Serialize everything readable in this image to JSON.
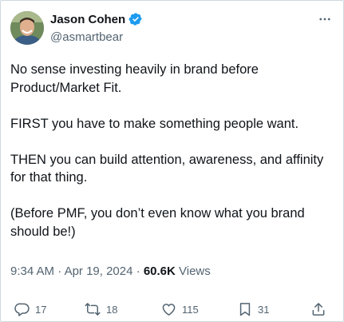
{
  "author": {
    "display_name": "Jason Cohen",
    "handle": "@asmartbear",
    "verified": true
  },
  "tweet": {
    "paragraphs": [
      "No sense investing heavily in brand before Product/Market Fit.",
      "FIRST you have to make something people want.",
      "THEN you can build attention, awareness, and affinity for that thing.",
      "(Before PMF, you don’t even know what you brand should be!)"
    ],
    "time": "9:34 AM",
    "separator": "·",
    "date": "Apr 19, 2024",
    "views_count": "60.6K",
    "views_label": "Views"
  },
  "actions": {
    "replies": "17",
    "reposts": "18",
    "likes": "115",
    "bookmarks": "31"
  },
  "icons": {
    "more": "more-horizontal-icon",
    "verified": "verified-badge-icon",
    "reply": "reply-icon",
    "repost": "repost-icon",
    "like": "heart-icon",
    "bookmark": "bookmark-icon",
    "share": "share-icon"
  },
  "colors": {
    "text": "#0f1419",
    "secondary": "#536471",
    "verified": "#1d9bf0",
    "border": "#cfd9de"
  }
}
